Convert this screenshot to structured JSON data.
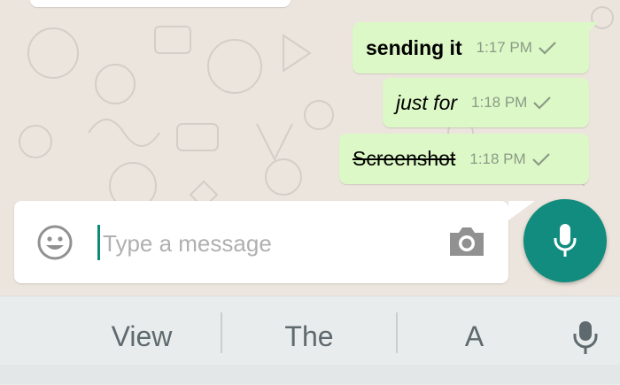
{
  "conversation": {
    "messages": [
      {
        "text": "sending it",
        "time": "1:17 PM",
        "style": "bold"
      },
      {
        "text": "just for",
        "time": "1:18 PM",
        "style": "italic"
      },
      {
        "text": "Screenshot",
        "time": "1:18 PM",
        "style": "strikethrough"
      }
    ]
  },
  "composer": {
    "placeholder": "Type a message",
    "value": ""
  },
  "keyboard": {
    "suggestions": [
      "View",
      "The",
      "A"
    ]
  },
  "colors": {
    "chat_bg": "#ece5dd",
    "outgoing_bubble": "#dcf8c6",
    "accent": "#128c7e",
    "tick": "#8c9a87"
  },
  "icons": {
    "emoji": "emoji-icon",
    "camera": "camera-icon",
    "mic": "mic-icon",
    "tick": "check-icon"
  }
}
